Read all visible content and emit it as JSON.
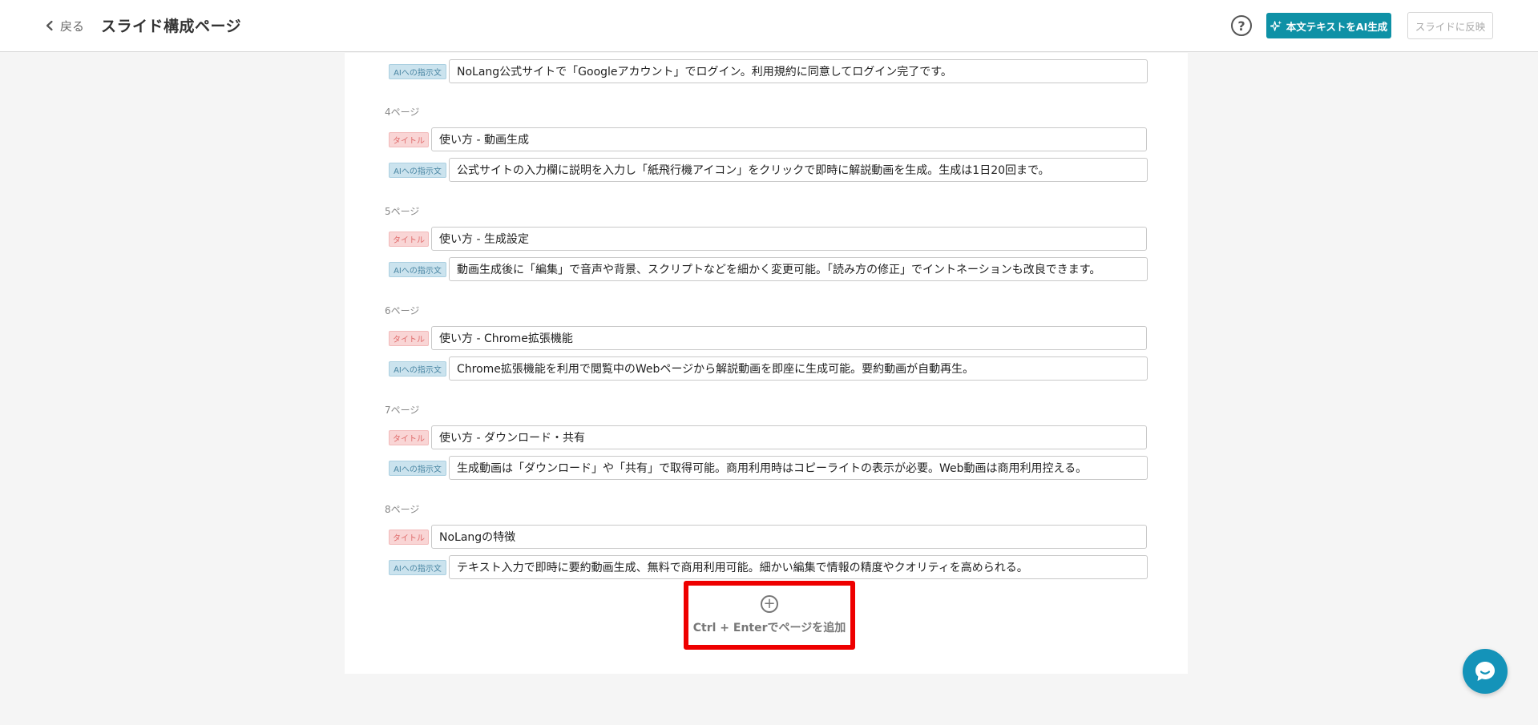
{
  "header": {
    "back_label": "戻る",
    "title": "スライド構成ページ",
    "help_glyph": "?",
    "ai_generate_label": "本文テキストをAI生成",
    "apply_label": "スライドに反映"
  },
  "tags": {
    "title": "タイトル",
    "ai": "AIへの指示文"
  },
  "slides": [
    {
      "page_label": "",
      "title": "",
      "instruction": "NoLang公式サイトで「Googleアカウント」でログイン。利用規約に同意してログイン完了です。"
    },
    {
      "page_label": "4ページ",
      "title": "使い方 - 動画生成",
      "instruction": "公式サイトの入力欄に説明を入力し「紙飛行機アイコン」をクリックで即時に解説動画を生成。生成は1日20回まで。"
    },
    {
      "page_label": "5ページ",
      "title": "使い方 - 生成設定",
      "instruction": "動画生成後に「編集」で音声や背景、スクリプトなどを細かく変更可能。「読み方の修正」でイントネーションも改良できます。"
    },
    {
      "page_label": "6ページ",
      "title": "使い方 - Chrome拡張機能",
      "instruction": "Chrome拡張機能を利用で閲覧中のWebページから解説動画を即座に生成可能。要約動画が自動再生。"
    },
    {
      "page_label": "7ページ",
      "title": "使い方 - ダウンロード・共有",
      "instruction": "生成動画は「ダウンロード」や「共有」で取得可能。商用利用時はコピーライトの表示が必要。Web動画は商用利用控える。"
    },
    {
      "page_label": "8ページ",
      "title": "NoLangの特徴",
      "instruction": "テキスト入力で即時に要約動画生成、無料で商用利用可能。細かい編集で情報の精度やクオリティを高められる。"
    }
  ],
  "add_page": {
    "icon_glyph": "+",
    "label": "Ctrl + Enterでページを追加"
  },
  "colors": {
    "accent": "#0e91a6",
    "highlight_border": "#ee0000",
    "chat_button": "#1493b9"
  }
}
